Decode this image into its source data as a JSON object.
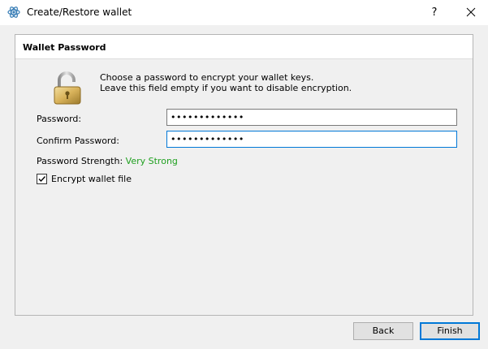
{
  "window": {
    "title": "Create/Restore wallet",
    "help_label": "?",
    "close_icon": "close-icon",
    "app_icon": "electrum-icon"
  },
  "panel": {
    "title": "Wallet Password",
    "lock_icon": "padlock-icon",
    "description_line1": "Choose a password to encrypt your wallet keys.",
    "description_line2": "Leave this field empty if you want to disable encryption."
  },
  "form": {
    "password_label": "Password:",
    "password_value": "•••••••••••••",
    "confirm_label": "Confirm Password:",
    "confirm_value": "•••••••••••••",
    "strength_label": "Password Strength: ",
    "strength_value": "Very Strong",
    "strength_color": "#20a020",
    "encrypt_checked": true,
    "encrypt_label": "Encrypt wallet file"
  },
  "buttons": {
    "back_label": "Back",
    "finish_label": "Finish"
  },
  "colors": {
    "focus_border": "#0078d7",
    "app_icon": "#3a7fb7"
  }
}
